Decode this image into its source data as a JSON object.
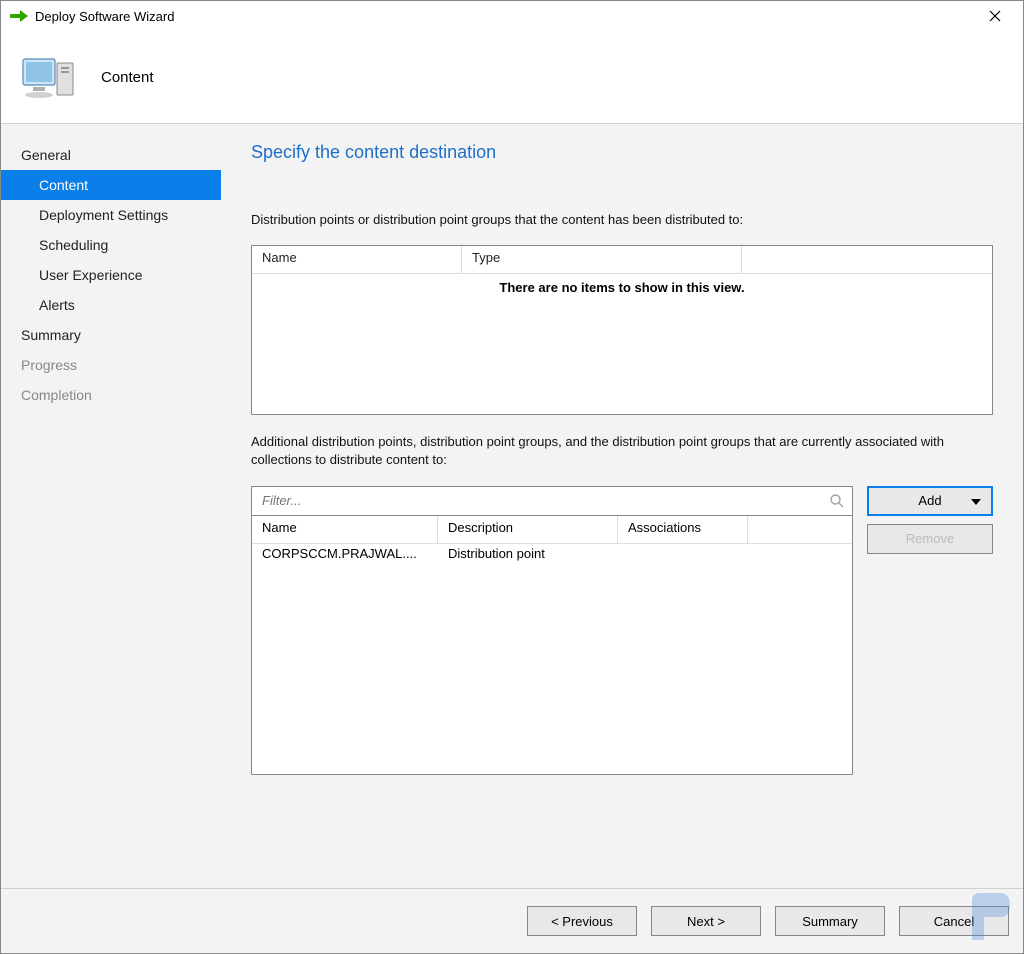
{
  "window": {
    "title": "Deploy Software Wizard"
  },
  "header": {
    "title": "Content"
  },
  "sidebar": {
    "items": [
      {
        "label": "General",
        "level": "top",
        "state": "normal"
      },
      {
        "label": "Content",
        "level": "sub",
        "state": "selected"
      },
      {
        "label": "Deployment Settings",
        "level": "sub",
        "state": "normal"
      },
      {
        "label": "Scheduling",
        "level": "sub",
        "state": "normal"
      },
      {
        "label": "User Experience",
        "level": "sub",
        "state": "normal"
      },
      {
        "label": "Alerts",
        "level": "sub",
        "state": "normal"
      },
      {
        "label": "Summary",
        "level": "top",
        "state": "normal"
      },
      {
        "label": "Progress",
        "level": "top",
        "state": "disabled"
      },
      {
        "label": "Completion",
        "level": "top",
        "state": "disabled"
      }
    ]
  },
  "content": {
    "heading": "Specify the content destination",
    "desc1": "Distribution points or distribution point groups that the content has been distributed to:",
    "table1": {
      "cols": [
        "Name",
        "Type"
      ],
      "empty": "There are no items to show in this view."
    },
    "desc2": "Additional distribution points, distribution point groups, and the distribution point groups that are currently associated with collections to distribute content to:",
    "filter_placeholder": "Filter...",
    "table2": {
      "cols": [
        "Name",
        "Description",
        "Associations"
      ],
      "rows": [
        {
          "name": "CORPSCCM.PRAJWAL....",
          "description": "Distribution point",
          "associations": ""
        }
      ]
    },
    "add_label": "Add",
    "remove_label": "Remove"
  },
  "footer": {
    "previous": "< Previous",
    "next": "Next >",
    "summary": "Summary",
    "cancel": "Cancel"
  }
}
